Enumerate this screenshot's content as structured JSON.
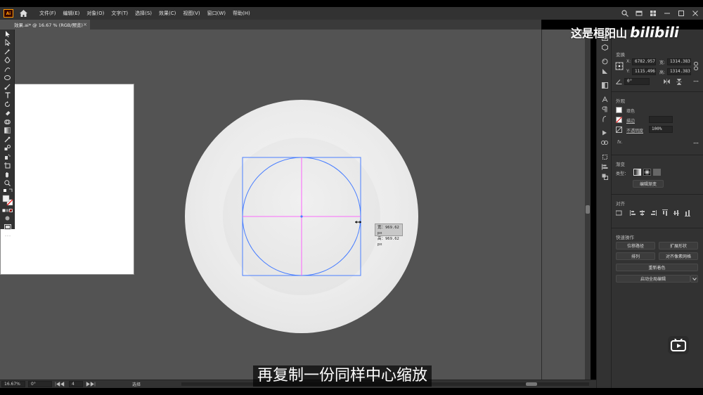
{
  "app": {
    "logo": "Ai"
  },
  "menu": [
    "文件(F)",
    "编辑(E)",
    "对象(O)",
    "文字(T)",
    "选择(S)",
    "效果(C)",
    "视图(V)",
    "窗口(W)",
    "帮助(H)"
  ],
  "tab": {
    "title": "效果.ai* @ 16.67 % (RGB/预览)",
    "close": "×"
  },
  "selection_tooltip": {
    "width": "宽：969.62 px",
    "height": "高：969.62 px"
  },
  "panel": {
    "transform": {
      "title": "变换",
      "x_label": "X:",
      "x_value": "6782.957",
      "y_label": "Y:",
      "y_value": "1115.496",
      "w_label": "宽:",
      "w_value": "1314.383",
      "h_label": "高:",
      "h_value": "1314.383",
      "angle_value": "0°"
    },
    "appearance": {
      "title": "外观",
      "fill_label": "填色",
      "stroke_label": "描边",
      "opacity_label": "不透明度",
      "opacity_value": "100%",
      "fx": "fx."
    },
    "gradient": {
      "title": "渐变",
      "type_label": "类型：",
      "edit_button": "编辑渐变"
    },
    "align": {
      "title": "对齐"
    },
    "quick_actions": {
      "title": "快速操作",
      "offset_path": "位移路径",
      "expand_shape": "扩展形状",
      "arrange": "排列",
      "align_pixel_grid": "对齐像素网格",
      "recolor": "重新着色",
      "global_edit": "启动全局编辑"
    }
  },
  "status": {
    "zoom": "16.67%",
    "rotation": "0°",
    "artboard": "4",
    "mode": "选择"
  },
  "watermark": {
    "author": "这是桓阳山",
    "site": "bilibili"
  },
  "subtitle": "再复制一份同样中心缩放",
  "colors": {
    "bezel": "#000000",
    "ui_dark": "#323232",
    "canvas": "#535353",
    "selection_blue": "#4a7fff",
    "guide_magenta": "#ff40ff"
  }
}
